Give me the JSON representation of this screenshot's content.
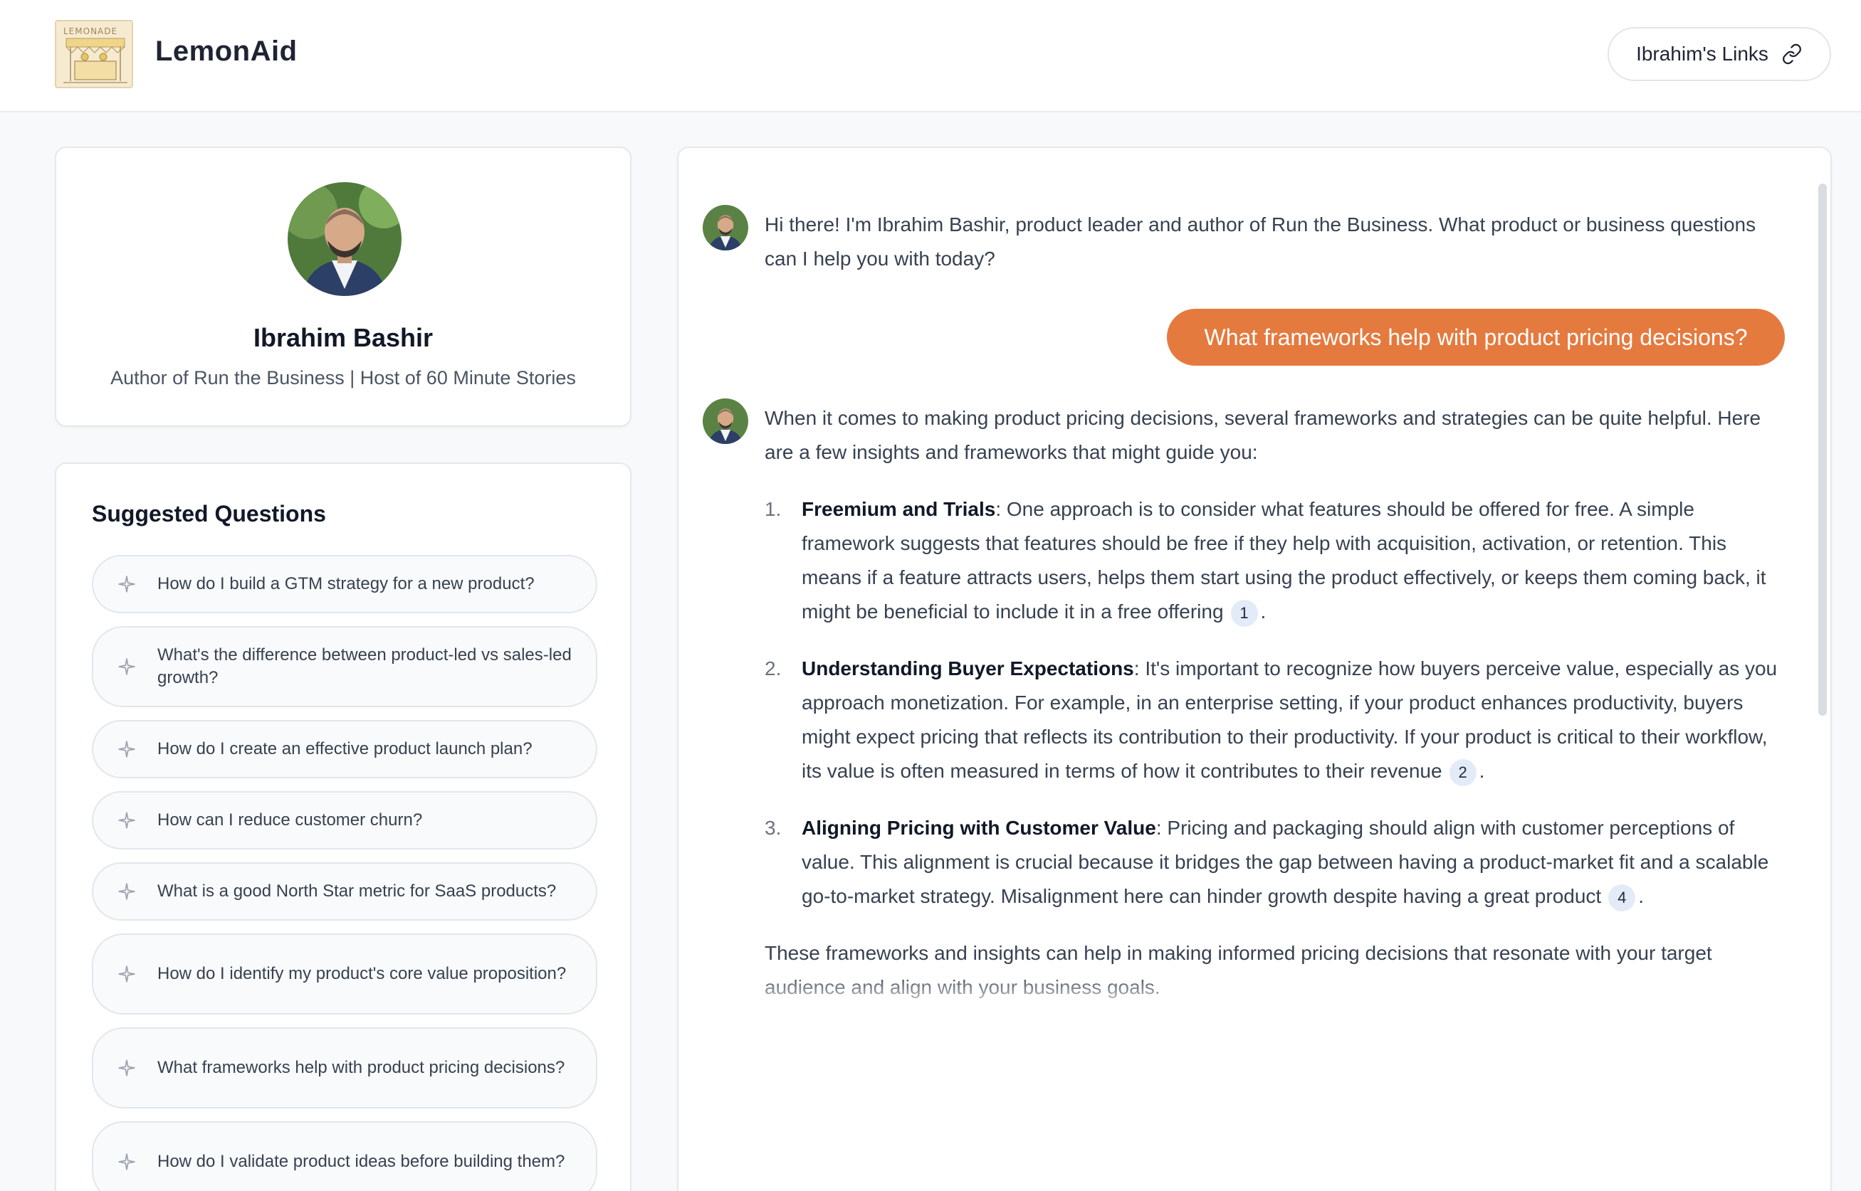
{
  "app": {
    "title": "LemonAid",
    "logo_text": "LEMONADE"
  },
  "header": {
    "links_button_label": "Ibrahim's Links"
  },
  "profile": {
    "name": "Ibrahim Bashir",
    "subtitle": "Author of Run the Business | Host of 60 Minute Stories"
  },
  "suggested": {
    "title": "Suggested Questions",
    "questions": [
      "How do I build a GTM strategy for a new product?",
      "What's the difference between product-led vs sales-led growth?",
      "How do I create an effective product launch plan?",
      "How can I reduce customer churn?",
      "What is a good North Star metric for SaaS products?",
      "How do I identify my product's core value proposition?",
      "What frameworks help with product pricing decisions?",
      "How do I validate product ideas before building them?"
    ]
  },
  "chat": {
    "greeting": "Hi there! I'm Ibrahim Bashir, product leader and author of Run the Business. What product or business questions can I help you with today?",
    "user_message": "What frameworks help with product pricing decisions?",
    "answer_intro": "When it comes to making product pricing decisions, several frameworks and strategies can be quite helpful. Here are a few insights and frameworks that might guide you:",
    "answer_items": [
      {
        "num": "1.",
        "title": "Freemium and Trials",
        "text": ": One approach is to consider what features should be offered for free. A simple framework suggests that features should be free if they help with acquisition, activation, or retention. This means if a feature attracts users, helps them start using the product effectively, or keeps them coming back, it might be beneficial to include it in a free offering",
        "cite": "1"
      },
      {
        "num": "2.",
        "title": "Understanding Buyer Expectations",
        "text": ": It's important to recognize how buyers perceive value, especially as you approach monetization. For example, in an enterprise setting, if your product enhances productivity, buyers might expect pricing that reflects its contribution to their productivity. If your product is critical to their workflow, its value is often measured in terms of how it contributes to their revenue",
        "cite": "2"
      },
      {
        "num": "3.",
        "title": "Aligning Pricing with Customer Value",
        "text": ": Pricing and packaging should align with customer perceptions of value. This alignment is crucial because it bridges the gap between having a product-market fit and a scalable go-to-market strategy. Misalignment here can hinder growth despite having a great product",
        "cite": "4"
      }
    ],
    "answer_outro": "These frameworks and insights can help in making informed pricing decisions that resonate with your target audience and align with your business goals."
  },
  "colors": {
    "accent": "#e57a3f",
    "citation_bg": "#e3ebf8"
  }
}
